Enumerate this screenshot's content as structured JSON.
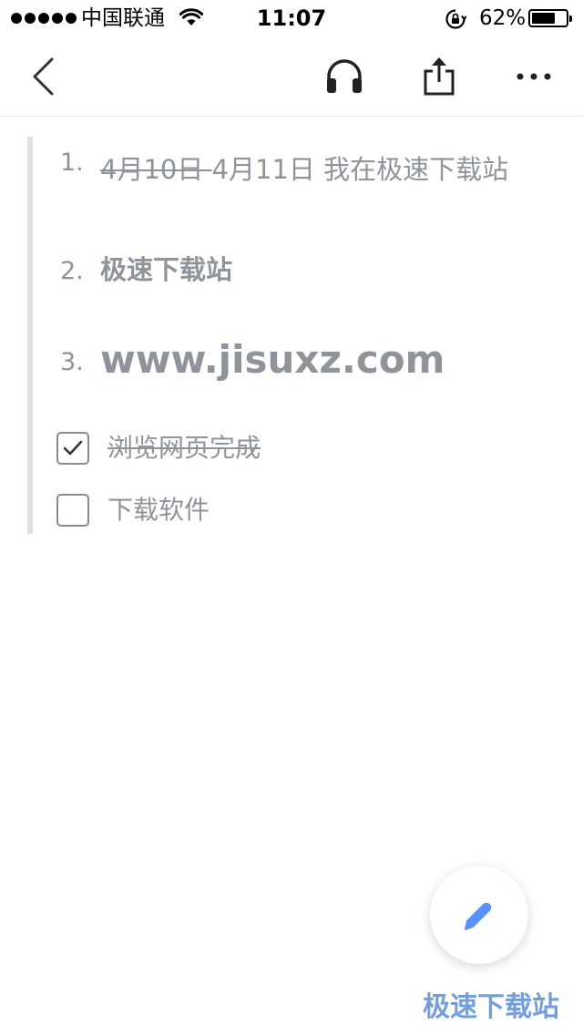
{
  "status_bar": {
    "carrier": "中国联通",
    "time": "11:07",
    "battery_percent": "62%",
    "battery_level": 0.62,
    "signal_icon": "signal-dots-icon",
    "wifi_icon": "wifi-icon",
    "orientation_lock_icon": "orientation-lock-icon"
  },
  "toolbar": {
    "back_icon": "chevron-left-icon",
    "audio_icon": "headphones-icon",
    "share_icon": "share-icon",
    "more_icon": "more-dots-icon"
  },
  "note": {
    "ordered_list": [
      {
        "number": "1.",
        "struck_text": "4月10日 ",
        "text": "4月11日 我在极速下载站"
      },
      {
        "number": "2.",
        "text": "极速下载站"
      },
      {
        "number": "3.",
        "text": "www.jisuxz.com"
      }
    ],
    "todos": [
      {
        "label": "浏览网页完成",
        "checked": true
      },
      {
        "label": "下载软件",
        "checked": false
      }
    ]
  },
  "fab": {
    "icon": "pencil-icon",
    "color": "#5b8ff9"
  },
  "watermark": "极速下载站",
  "colors": {
    "text_gray": "#8e9499",
    "accent_blue": "#5b8ff9",
    "divider": "#e6e6e6"
  }
}
